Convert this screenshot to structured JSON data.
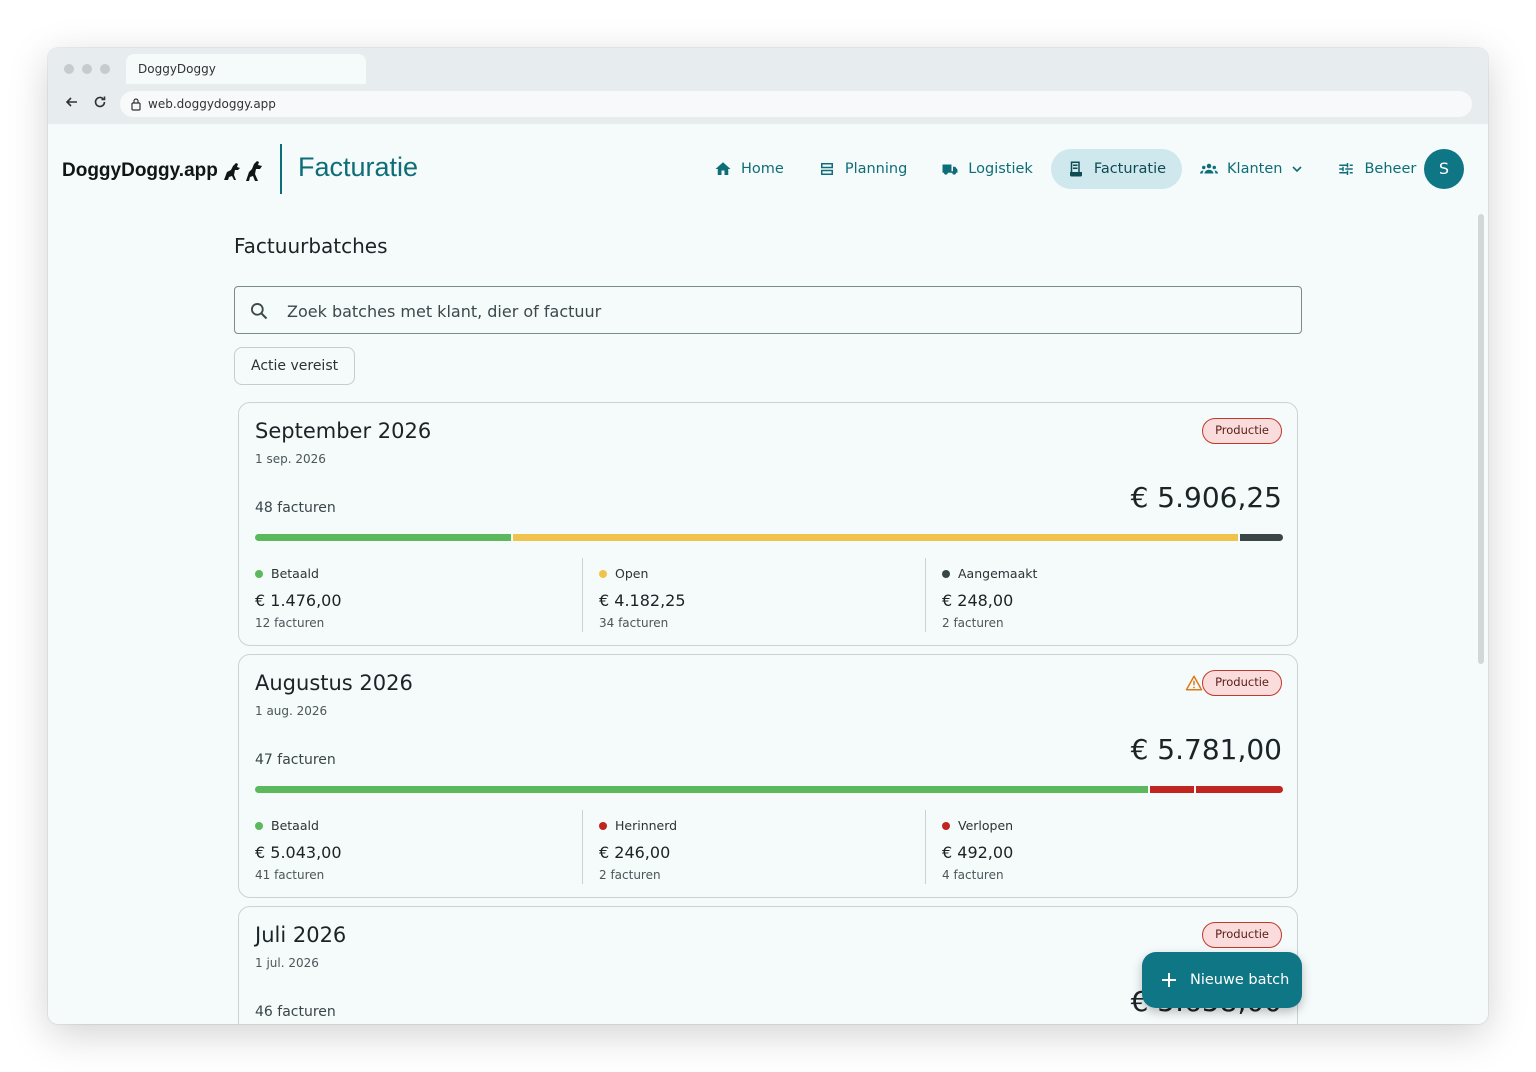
{
  "browser": {
    "tab_title": "DoggyDoggy",
    "url": "web.doggydoggy.app"
  },
  "app": {
    "logo_text": "DoggyDoggy.app",
    "section_title": "Facturatie",
    "nav": [
      {
        "label": "Home",
        "icon": "home-icon"
      },
      {
        "label": "Planning",
        "icon": "planning-icon"
      },
      {
        "label": "Logistiek",
        "icon": "truck-icon"
      },
      {
        "label": "Facturatie",
        "icon": "invoice-icon",
        "active": true
      },
      {
        "label": "Klanten",
        "icon": "people-icon",
        "dropdown": true
      },
      {
        "label": "Beheer",
        "icon": "sliders-icon"
      }
    ],
    "avatar_initial": "S"
  },
  "page": {
    "heading": "Factuurbatches",
    "search_placeholder": "Zoek batches met klant, dier of factuur",
    "filter_chip": "Actie vereist",
    "fab_label": "Nieuwe batch"
  },
  "colors": {
    "accent": "#0e7684",
    "paid": "#5cb85c",
    "open": "#f0c44c",
    "created": "#3a4548",
    "overdue": "#c0261f"
  },
  "batches": [
    {
      "title": "September 2026",
      "date": "1 sep. 2026",
      "badge": "Productie",
      "warning": false,
      "count": "48 facturen",
      "total": "€ 5.906,25",
      "stats": [
        {
          "label": "Betaald",
          "amount": "€ 1.476,00",
          "sub": "12 facturen",
          "color": "#5cb85c",
          "share": 0.2499
        },
        {
          "label": "Open",
          "amount": "€ 4.182,25",
          "sub": "34 facturen",
          "color": "#f0c44c",
          "share": 0.7081
        },
        {
          "label": "Aangemaakt",
          "amount": "€ 248,00",
          "sub": "2 facturen",
          "color": "#3a4548",
          "share": 0.042
        }
      ]
    },
    {
      "title": "Augustus 2026",
      "date": "1 aug. 2026",
      "badge": "Productie",
      "warning": true,
      "count": "47 facturen",
      "total": "€ 5.781,00",
      "stats": [
        {
          "label": "Betaald",
          "amount": "€ 5.043,00",
          "sub": "41 facturen",
          "color": "#5cb85c",
          "share": 0.8723
        },
        {
          "label": "Herinnerd",
          "amount": "€ 246,00",
          "sub": "2 facturen",
          "color": "#c0261f",
          "share": 0.0426
        },
        {
          "label": "Verlopen",
          "amount": "€ 492,00",
          "sub": "4 facturen",
          "color": "#c0261f",
          "share": 0.0851
        }
      ]
    },
    {
      "title": "Juli 2026",
      "date": "1 jul. 2026",
      "badge": "Productie",
      "warning": false,
      "count": "46 facturen",
      "total": "€ 5.658,00",
      "stats": []
    }
  ]
}
